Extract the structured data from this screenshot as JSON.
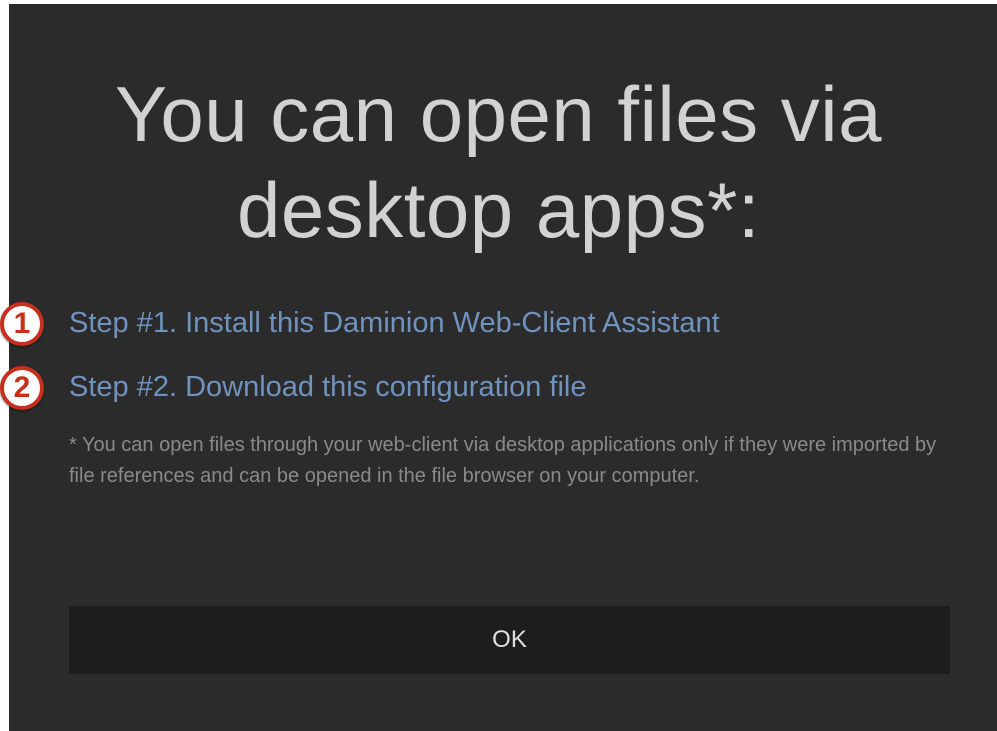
{
  "dialog": {
    "title": "You can open files via desktop apps*:",
    "steps": [
      {
        "marker": "1",
        "label": "Step #1. Install this Daminion Web-Client Assistant"
      },
      {
        "marker": "2",
        "label": "Step #2. Download this configuration file"
      }
    ],
    "footnote": "* You can open files through your web-client via desktop applications only if they were imported by file references and can be opened in the file browser on your computer.",
    "ok_label": "OK"
  },
  "colors": {
    "background": "#2b2b2b",
    "title": "#d2d2d2",
    "link": "#6f93be",
    "footnote": "#8a8a8a",
    "button": "#1d1d1d",
    "marker_border": "#c8301e"
  }
}
